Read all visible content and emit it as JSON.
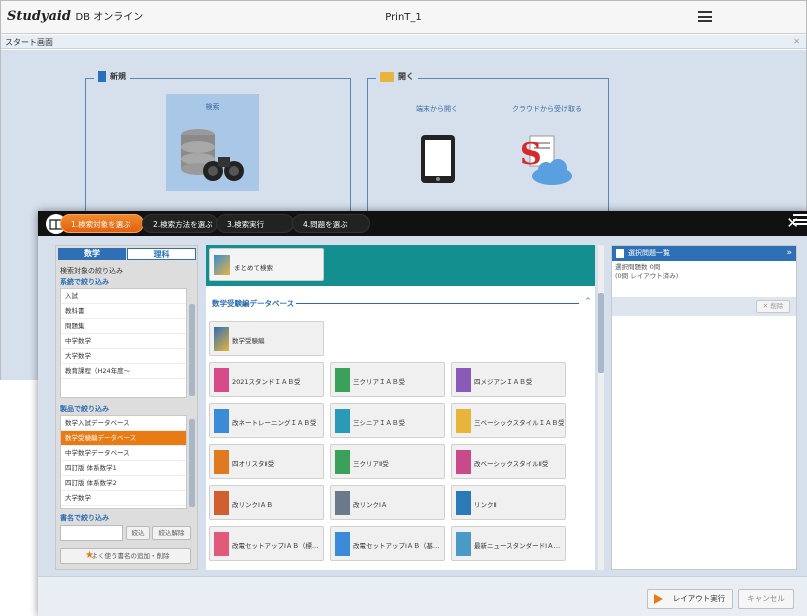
{
  "app": {
    "logo_main": "Studyaid",
    "logo_sub": "DB オンライン",
    "title": "PrinT_1",
    "start_screen": "スタート画面"
  },
  "start": {
    "new_panel": {
      "title": "新規",
      "search_label": "検索"
    },
    "open_panel": {
      "title": "開く",
      "local_label": "端末から開く",
      "cloud_label": "クラウドから受け取る"
    }
  },
  "wizard": {
    "steps": [
      {
        "label": "1.検索対象を選ぶ"
      },
      {
        "label": "2.検索方法を選ぶ"
      },
      {
        "label": "3.検索実行"
      },
      {
        "label": "4.問題を選ぶ"
      }
    ],
    "close_label": "✕"
  },
  "left": {
    "tabs": [
      {
        "label": "数学"
      },
      {
        "label": "理科"
      }
    ],
    "filter_title": "検索対象の絞り込み",
    "system_title": "系統で絞り込み",
    "system_items": [
      "入試",
      "教科書",
      "問題集",
      "中学数学",
      "大学数学",
      "教育課程（H24年度〜"
    ],
    "product_title": "製品で絞り込み",
    "product_items": [
      "数学入試データベース",
      "数学受験編データベース",
      "中学数学データベース",
      "四訂版 体系数学1",
      "四訂版 体系数学2",
      "大学数学"
    ],
    "book_title": "書名で絞り込み",
    "narrow_label": "絞込",
    "clear_label": "絞込解除",
    "bookmark_label": "よく使う書名の追加・削除"
  },
  "middle": {
    "batch_label": "まとめて検索",
    "section_title": "数学受験編データベース",
    "section_chevron": "^",
    "top_book": "数学受験編",
    "books": [
      {
        "label": "2021スタンドＩＡＢ受",
        "color": "#d64a8a"
      },
      {
        "label": "三クリアＩＡＢ受",
        "color": "#3aa05a"
      },
      {
        "label": "四メジアンＩＡＢ受",
        "color": "#8a5ab8"
      },
      {
        "label": "改ネートレーニングＩＡＢ受",
        "color": "#3a8cd8"
      },
      {
        "label": "三シニアＩＡＢ受",
        "color": "#2a9ab8"
      },
      {
        "label": "三ベーシックスタイルＩＡＢ受",
        "color": "#e8b43c"
      },
      {
        "label": "四オリスタⅡ受",
        "color": "#e07a20"
      },
      {
        "label": "三クリアⅡ受",
        "color": "#3aa05a"
      },
      {
        "label": "改ベーシックスタイルⅡ受",
        "color": "#c84a8a"
      },
      {
        "label": "改リンクⅠＡＢ",
        "color": "#d06030"
      },
      {
        "label": "改リンクⅠＡ",
        "color": "#6a7a8a"
      },
      {
        "label": "リンクⅡ",
        "color": "#2a7ab8"
      },
      {
        "label": "改電セットアップⅠＡＢ（標…",
        "color": "#e05a7a"
      },
      {
        "label": "改電セットアップⅠＡＢ（基…",
        "color": "#3a8cd8"
      },
      {
        "label": "最新ニュースタンダードⅠＡ…",
        "color": "#4a9ac8"
      }
    ]
  },
  "right": {
    "title": "選択問題一覧",
    "chevron": "»",
    "line1": "選択問題数 0問",
    "line2": "(0問 レイアウト済み)",
    "delete_label": "✕ 削除"
  },
  "footer": {
    "layout_label": "レイアウト実行",
    "cancel_label": "キャンセル"
  },
  "colors": {
    "accent": "#e97b14",
    "teal": "#138f8f",
    "blue": "#2e6fb5"
  }
}
